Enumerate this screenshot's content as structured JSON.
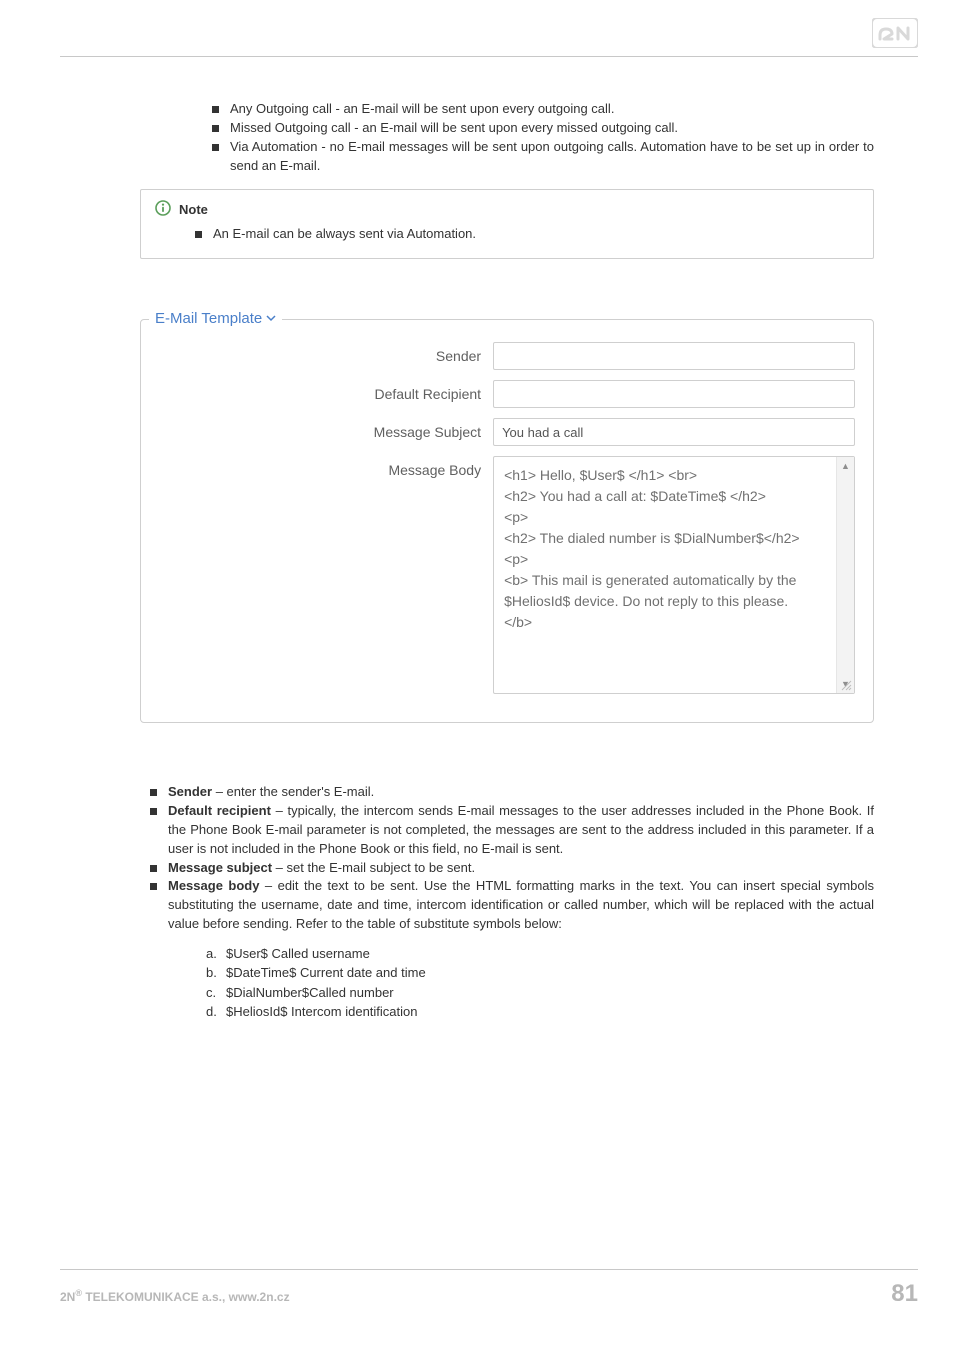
{
  "top_bullets": [
    "Any Outgoing call - an E-mail will be sent upon every outgoing call.",
    "Missed Outgoing call - an E-mail will be sent upon every missed outgoing call.",
    "Via Automation - no E-mail messages will be sent upon outgoing calls. Automation have to be set up in order to send an E-mail."
  ],
  "note": {
    "title": "Note",
    "items": [
      "An E-mail can be always sent via Automation."
    ]
  },
  "fieldset": {
    "legend": "E-Mail Template",
    "rows": {
      "sender": {
        "label": "Sender",
        "value": ""
      },
      "default_recipient": {
        "label": "Default Recipient",
        "value": ""
      },
      "message_subject": {
        "label": "Message Subject",
        "value": "You had a call"
      },
      "message_body": {
        "label": "Message Body",
        "value": "<h1> Hello, $User$ </h1> <br>\n<h2> You had a call at: $DateTime$ </h2>\n<p>\n<h2> The dialed number is $DialNumber$</h2>\n<p>\n<b> This mail is generated automatically by the $HeliosId$ device. Do not reply to this please.\n</b>"
      }
    }
  },
  "explain": [
    {
      "term": "Sender",
      "text": " – enter the sender's E-mail."
    },
    {
      "term": "Default recipient",
      "text": " – typically, the intercom sends E-mail messages to the user addresses included in the Phone Book. If the Phone Book E-mail parameter is not completed, the messages are sent to the address included in this parameter. If a user is not included in the Phone Book or this field, no E-mail is sent."
    },
    {
      "term": "Message subject",
      "text": " – set the E-mail subject to be sent."
    },
    {
      "term": "Message body",
      "text": " – edit the text to be sent. Use the HTML formatting marks in the text. You can insert special symbols substituting the username, date and time, intercom identification or called number, which will be replaced with the actual value before sending. Refer to the table of substitute symbols below:"
    }
  ],
  "sublist": [
    {
      "marker": "a.",
      "text": "$User$ Called username"
    },
    {
      "marker": "b.",
      "text": "$DateTime$ Current date and time"
    },
    {
      "marker": "c.",
      "text": "$DialNumber$Called number"
    },
    {
      "marker": "d.",
      "text": "$HeliosId$ Intercom identification"
    }
  ],
  "footer": {
    "company_prefix": "2N",
    "company_reg": "®",
    "company_rest": " TELEKOMUNIKACE a.s., www.2n.cz",
    "page": "81"
  }
}
